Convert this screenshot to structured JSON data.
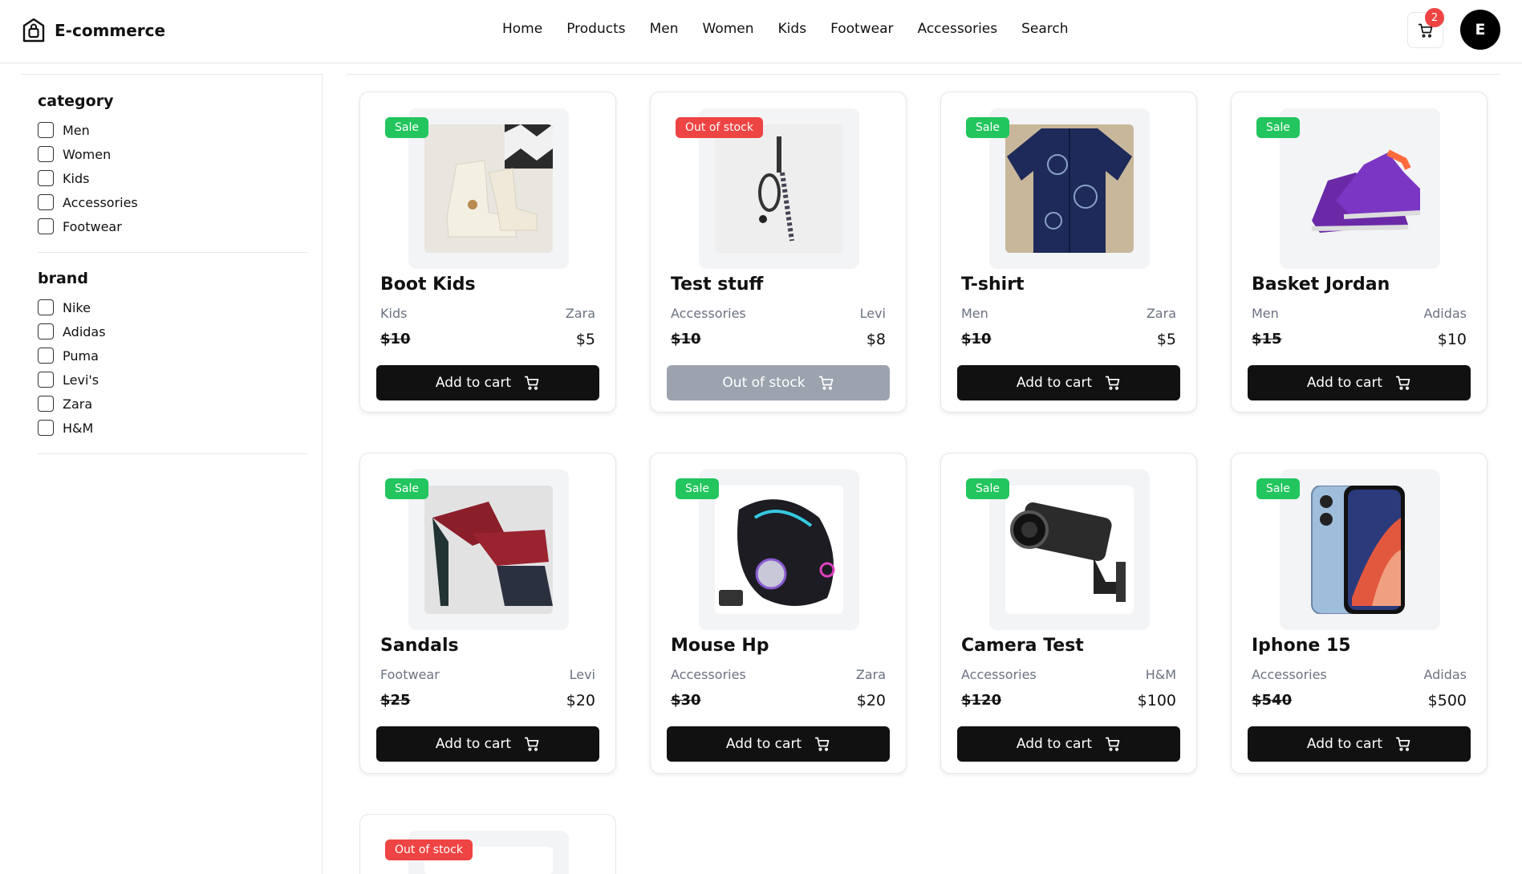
{
  "header": {
    "brand_name": "E-commerce",
    "nav": [
      "Home",
      "Products",
      "Men",
      "Women",
      "Kids",
      "Footwear",
      "Accessories",
      "Search"
    ],
    "cart_count": "2",
    "avatar_initial": "E"
  },
  "sidebar": {
    "category_title": "category",
    "categories": [
      "Men",
      "Women",
      "Kids",
      "Accessories",
      "Footwear"
    ],
    "brand_title": "brand",
    "brands": [
      "Nike",
      "Adidas",
      "Puma",
      "Levi's",
      "Zara",
      "H&M"
    ]
  },
  "products": [
    {
      "name": "Boot Kids",
      "category": "Kids",
      "brand": "Zara",
      "old_price": "$10",
      "price": "$5",
      "badge": "Sale",
      "button": "Add to cart",
      "image": "kids-boots",
      "in_stock": true
    },
    {
      "name": "Test stuff",
      "category": "Accessories",
      "brand": "Levi",
      "old_price": "$10",
      "price": "$8",
      "badge": "Out of stock",
      "button": "Out of stock",
      "image": "keychain-lanyard",
      "in_stock": false
    },
    {
      "name": "T-shirt",
      "category": "Men",
      "brand": "Zara",
      "old_price": "$10",
      "price": "$5",
      "badge": "Sale",
      "button": "Add to cart",
      "image": "navy-shirt",
      "in_stock": true
    },
    {
      "name": "Basket Jordan",
      "category": "Men",
      "brand": "Adidas",
      "old_price": "$15",
      "price": "$10",
      "badge": "Sale",
      "button": "Add to cart",
      "image": "purple-sneakers",
      "in_stock": true
    },
    {
      "name": "Sandals",
      "category": "Footwear",
      "brand": "Levi",
      "old_price": "$25",
      "price": "$20",
      "badge": "Sale",
      "button": "Add to cart",
      "image": "red-sandals",
      "in_stock": true
    },
    {
      "name": "Mouse Hp",
      "category": "Accessories",
      "brand": "Zara",
      "old_price": "$30",
      "price": "$20",
      "badge": "Sale",
      "button": "Add to cart",
      "image": "gaming-mouse",
      "in_stock": true
    },
    {
      "name": "Camera Test",
      "category": "Accessories",
      "brand": "H&M",
      "old_price": "$120",
      "price": "$100",
      "badge": "Sale",
      "button": "Add to cart",
      "image": "security-camera",
      "in_stock": true
    },
    {
      "name": "Iphone 15",
      "category": "Accessories",
      "brand": "Adidas",
      "old_price": "$540",
      "price": "$500",
      "badge": "Sale",
      "button": "Add to cart",
      "image": "smartphone",
      "in_stock": true
    },
    {
      "name": "",
      "category": "",
      "brand": "",
      "old_price": "",
      "price": "",
      "badge": "Out of stock",
      "button": "",
      "image": "product-image",
      "in_stock": false
    }
  ],
  "colors": {
    "sale_badge": "#22c55e",
    "out_of_stock_badge": "#ef4444",
    "primary_button": "#111111",
    "disabled_button": "#9ca3af"
  }
}
